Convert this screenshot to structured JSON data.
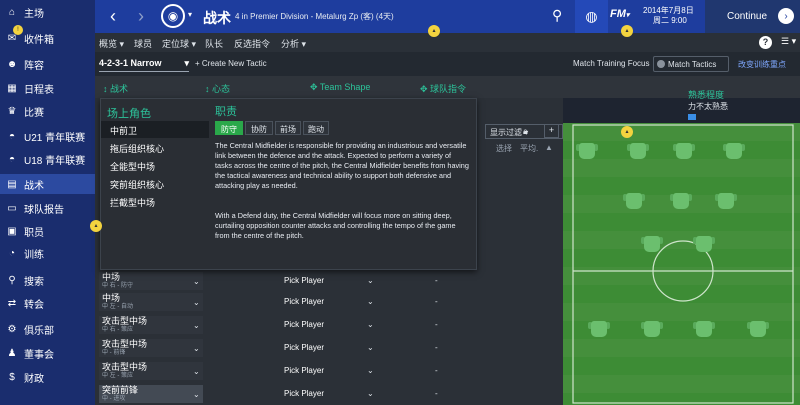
{
  "sidebar": {
    "items": [
      {
        "label": "主场",
        "icon": "home-icon"
      },
      {
        "label": "收件箱",
        "icon": "inbox-icon"
      },
      {
        "label": "阵容",
        "icon": "squad-icon"
      },
      {
        "label": "日程表",
        "icon": "calendar-icon"
      },
      {
        "label": "比赛",
        "icon": "trophy-icon"
      },
      {
        "label": "U21 青年联赛",
        "icon": "u21-icon"
      },
      {
        "label": "U18 青年联赛",
        "icon": "u18-icon"
      },
      {
        "label": "战术",
        "icon": "tactics-icon"
      },
      {
        "label": "球队报告",
        "icon": "report-icon"
      },
      {
        "label": "职员",
        "icon": "staff-icon"
      },
      {
        "label": "训练",
        "icon": "training-icon"
      },
      {
        "label": "搜索",
        "icon": "search-icon"
      },
      {
        "label": "转会",
        "icon": "transfer-icon"
      },
      {
        "label": "俱乐部",
        "icon": "club-icon"
      },
      {
        "label": "董事会",
        "icon": "board-icon"
      },
      {
        "label": "财政",
        "icon": "finance-icon"
      }
    ]
  },
  "topbar": {
    "title": "战术",
    "subtitle": "4 in Premier Division - Metalurg Zp (客) (4天)",
    "date_line1": "2014年7月8日",
    "date_line2": "周二 9:00",
    "continue_label": "Continue"
  },
  "menubar": {
    "items": [
      "概览",
      "球员",
      "定位球",
      "队长",
      "反选指令",
      "分析"
    ]
  },
  "tacticbar": {
    "formation": "4-2-3-1 Narrow",
    "new_tactic": "+ Create New Tactic",
    "match_training_focus": "Match Training Focus",
    "match_tactics": "Match Tactics",
    "change_focus": "改变训练重点"
  },
  "panel_headers": [
    "战术",
    "心态",
    "Team Shape",
    "球队指令"
  ],
  "familiarity": {
    "label": "熟悉程度",
    "value": "力不太熟悉"
  },
  "filter": {
    "label": "显示过滤"
  },
  "columns": {
    "select": "选择",
    "avg": "平均"
  },
  "rows": [
    {
      "pos": "中场",
      "sub": "中 右 - 防守",
      "pick": "Pick Player",
      "val": "-"
    },
    {
      "pos": "中场",
      "sub": "中 左 - 自动",
      "pick": "Pick Player",
      "val": "-"
    },
    {
      "pos": "攻击型中场",
      "sub": "中 右 - 策应",
      "pick": "Pick Player",
      "val": "-"
    },
    {
      "pos": "攻击型中场",
      "sub": "中 - 前锋",
      "pick": "Pick Player",
      "val": "-"
    },
    {
      "pos": "攻击型中场",
      "sub": "中 左 - 策应",
      "pick": "Pick Player",
      "val": "-"
    },
    {
      "pos": "突前前锋",
      "sub": "中 - 进攻",
      "pick": "Pick Player",
      "val": "-"
    }
  ],
  "popup": {
    "role_title": "场上角色",
    "roles": [
      "中前卫",
      "拖后组织核心",
      "全能型中场",
      "突前组织核心",
      "拦截型中场"
    ],
    "duty_title": "职责",
    "duties": [
      "防守",
      "协防",
      "前场",
      "跑动"
    ],
    "desc1": "The Central Midfielder is responsible for providing an industrious and versatile link between the defence and the attack. Expected to perform a variety of tasks across the centre of the pitch, the Central Midfielder benefits from having the tactical awareness and technical ability to support both defensive and attacking play as needed.",
    "desc2": "With a Defend duty, the Central Midfielder will focus more on sitting deep, curtailing opposition counter attacks and controlling the tempo of the game from the centre of the pitch."
  },
  "colors": {
    "sidebar": "#1a2d6e",
    "topbar": "#1e3d9e",
    "accent": "#2cc39a",
    "pitch": "#3d8c35",
    "duty_active": "#2aa84a"
  }
}
